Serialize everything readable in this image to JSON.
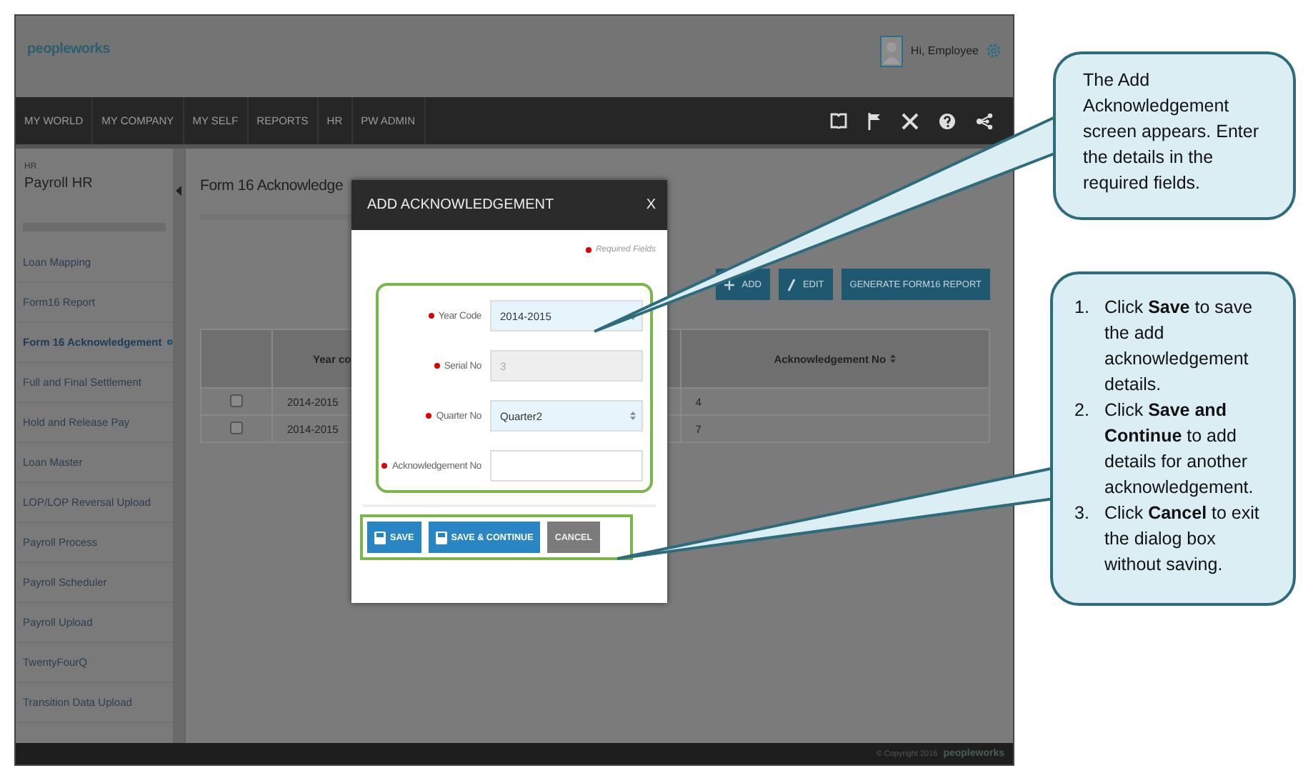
{
  "app": {
    "logo": "peopleworks",
    "greeting": "Hi, Employee",
    "nav": [
      "MY WORLD",
      "MY COMPANY",
      "MY SELF",
      "REPORTS",
      "HR",
      "PW ADMIN"
    ],
    "sidebar": {
      "section": "HR",
      "title": "Payroll HR",
      "items": [
        {
          "label": "Loan Mapping",
          "selected": false
        },
        {
          "label": "Form16 Report",
          "selected": false
        },
        {
          "label": "Form 16 Acknowledgement",
          "selected": true
        },
        {
          "label": "Full and Final Settlement",
          "selected": false
        },
        {
          "label": "Hold and Release Pay",
          "selected": false
        },
        {
          "label": "Loan Master",
          "selected": false
        },
        {
          "label": "LOP/LOP Reversal Upload",
          "selected": false
        },
        {
          "label": "Payroll Process",
          "selected": false
        },
        {
          "label": "Payroll Scheduler",
          "selected": false
        },
        {
          "label": "Payroll Upload",
          "selected": false
        },
        {
          "label": "TwentyFourQ",
          "selected": false
        },
        {
          "label": "Transition Data Upload",
          "selected": false
        }
      ]
    },
    "page_title": "Form 16 Acknowledge",
    "toolbar": [
      {
        "kind": "add",
        "label": "ADD"
      },
      {
        "kind": "edit",
        "label": "EDIT"
      },
      {
        "kind": "plain",
        "label": "GENERATE FORM16 REPORT"
      }
    ],
    "table": {
      "columns": [
        "",
        "Year co",
        "",
        "Acknowledgement No"
      ],
      "rows": [
        {
          "checked": false,
          "cells": [
            "",
            "2014-2015",
            "",
            "4"
          ]
        },
        {
          "checked": false,
          "cells": [
            "",
            "2014-2015",
            "",
            "7"
          ]
        }
      ]
    },
    "footer": {
      "copyright": "© Copyright 2016",
      "logo": "peopleworks"
    }
  },
  "dialog": {
    "title": "ADD ACKNOWLEDGEMENT",
    "close": "X",
    "required_note": "Required Fields",
    "fields": [
      {
        "label": "Year Code",
        "kind": "select",
        "value": "2014-2015",
        "disabled": false
      },
      {
        "label": "Serial No",
        "kind": "input",
        "value": "3",
        "disabled": true
      },
      {
        "label": "Quarter No",
        "kind": "select",
        "value": "Quarter2",
        "disabled": false
      },
      {
        "label": "Acknowledgement No",
        "kind": "input",
        "disabled": false
      }
    ],
    "buttons": [
      {
        "kind": "save",
        "label": "SAVE"
      },
      {
        "kind": "save",
        "label": "SAVE & CONTINUE"
      },
      {
        "kind": "cancel",
        "label": "CANCEL"
      }
    ]
  },
  "callouts": [
    {
      "kind": "text",
      "text": "The Add Acknowledgement screen appears. Enter the details in the required fields."
    },
    {
      "kind": "list",
      "items": [
        {
          "number": "1.",
          "text": "Click **Save** to save the add acknowledgement details."
        },
        {
          "number": "2.",
          "text": "Click **Save and Continue** to add details for another acknowledgement."
        },
        {
          "number": "3.",
          "text": "Click **Cancel** to exit the dialog box without saving."
        }
      ]
    }
  ]
}
